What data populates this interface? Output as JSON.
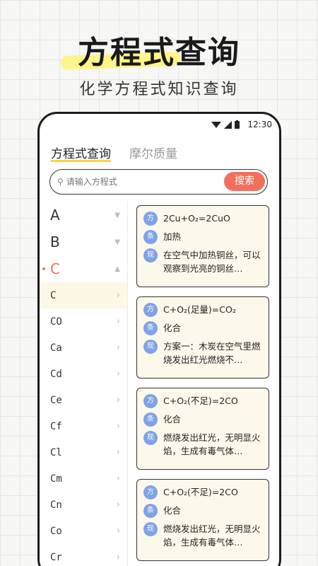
{
  "hero": {
    "title": "方程式查询",
    "subtitle": "化学方程式知识查询"
  },
  "status_bar": {
    "time": "12:30",
    "icons": [
      "wifi-icon",
      "signal-icon",
      "battery-icon"
    ]
  },
  "tabs": [
    {
      "label": "方程式查询",
      "active": true
    },
    {
      "label": "摩尔质量",
      "active": false
    }
  ],
  "search": {
    "placeholder": "请输入方程式",
    "button_label": "搜索"
  },
  "sidebar": {
    "letters": [
      {
        "letter": "A",
        "expanded": false
      },
      {
        "letter": "B",
        "expanded": false
      },
      {
        "letter": "C",
        "expanded": true
      }
    ],
    "elements": [
      "C",
      "CO",
      "Ca",
      "Cd",
      "Ce",
      "Cf",
      "Cl",
      "Cm",
      "Cn",
      "Co",
      "Cr"
    ],
    "selected_element": "C"
  },
  "badges": {
    "equation": "方",
    "condition": "条",
    "phenomenon": "现"
  },
  "cards": [
    {
      "equation": "2Cu+O₂=2CuO",
      "condition": "加热",
      "phenomenon": "在空气中加热铜丝，可以观察到光亮的铜丝…"
    },
    {
      "equation": "C+O₂(足量)=CO₂",
      "condition": "化合",
      "phenomenon": "方案一：木炭在空气里燃烧发出红光燃烧不…"
    },
    {
      "equation": "C+O₂(不足)=2CO",
      "condition": "化合",
      "phenomenon": "燃烧发出红光，无明显火焰，生成有毒气体…"
    },
    {
      "equation": "C+O₂(不足)=2CO",
      "condition": "化合",
      "phenomenon": "燃烧发出红光，无明显火焰，生成有毒气体…"
    }
  ],
  "colors": {
    "accent": "#f26f5e",
    "badge": "#7ea3e8",
    "highlight": "#fff48a",
    "card_bg": "#fdf9ea"
  }
}
